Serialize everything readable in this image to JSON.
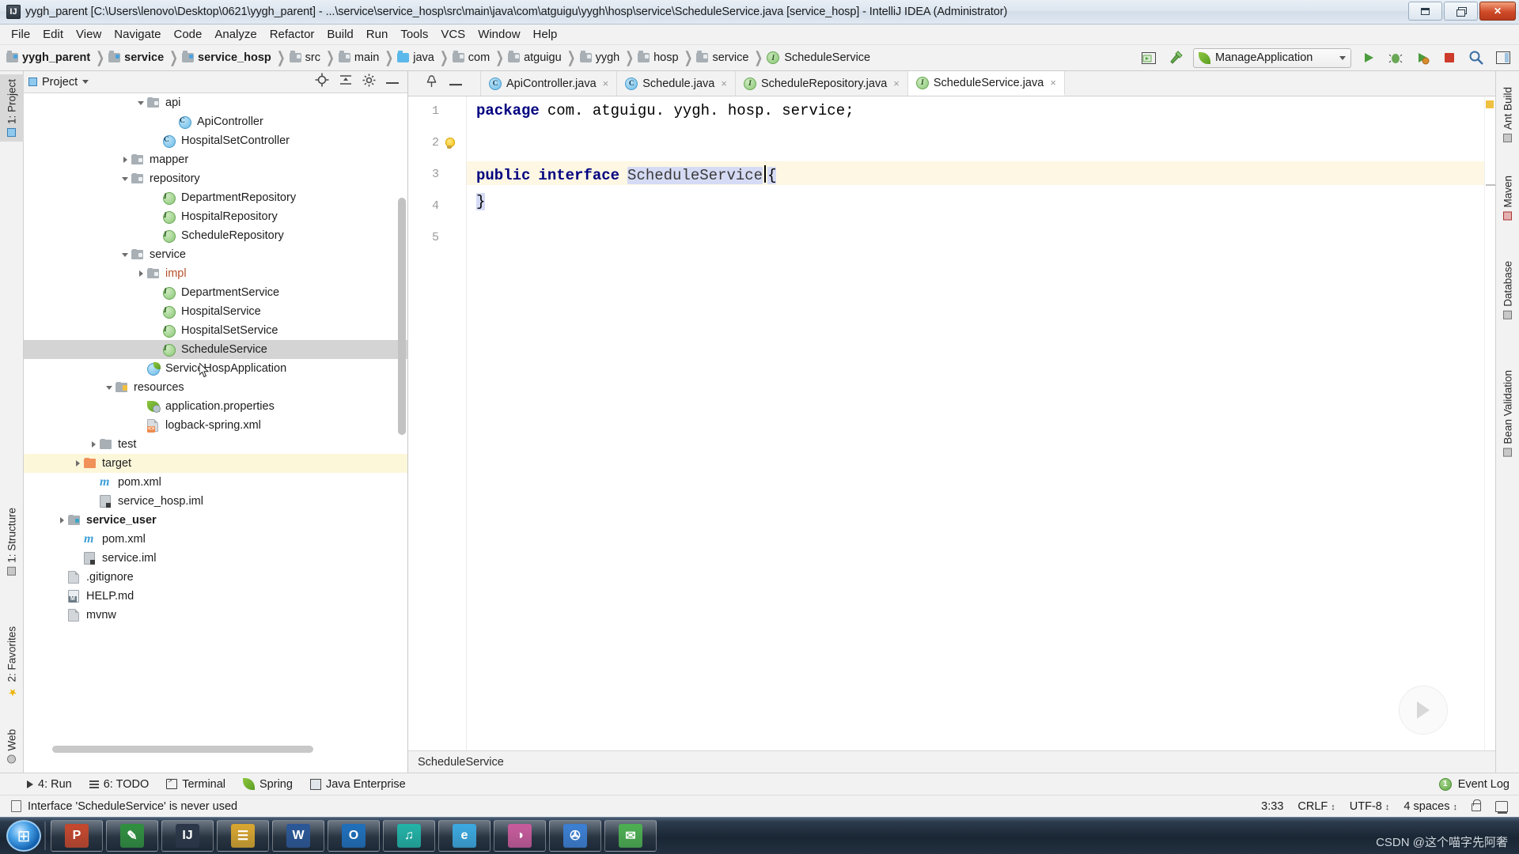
{
  "window": {
    "title": "yygh_parent [C:\\Users\\lenovo\\Desktop\\0621\\yygh_parent] - ...\\service\\service_hosp\\src\\main\\java\\com\\atguigu\\yygh\\hosp\\service\\ScheduleService.java [service_hosp] - IntelliJ IDEA (Administrator)",
    "app_badge": "IJ",
    "minimize_label": "Minimize",
    "restore_label": "Restore",
    "close_label": "✕"
  },
  "menubar": {
    "items": [
      "File",
      "Edit",
      "View",
      "Navigate",
      "Code",
      "Analyze",
      "Refactor",
      "Build",
      "Run",
      "Tools",
      "VCS",
      "Window",
      "Help"
    ]
  },
  "navbar": {
    "crumbs": [
      {
        "label": "yygh_parent",
        "icon": "folder-module-icon",
        "bold": true
      },
      {
        "label": "service",
        "icon": "folder-module-icon",
        "bold": true
      },
      {
        "label": "service_hosp",
        "icon": "folder-module-icon",
        "bold": true
      },
      {
        "label": "src",
        "icon": "folder-icon",
        "bold": false
      },
      {
        "label": "main",
        "icon": "folder-icon",
        "bold": false
      },
      {
        "label": "java",
        "icon": "folder-source-icon",
        "bold": false
      },
      {
        "label": "com",
        "icon": "folder-package-icon",
        "bold": false
      },
      {
        "label": "atguigu",
        "icon": "folder-package-icon",
        "bold": false
      },
      {
        "label": "yygh",
        "icon": "folder-package-icon",
        "bold": false
      },
      {
        "label": "hosp",
        "icon": "folder-package-icon",
        "bold": false
      },
      {
        "label": "service",
        "icon": "folder-package-icon",
        "bold": false
      },
      {
        "label": "ScheduleService",
        "icon": "interface-icon",
        "bold": false
      }
    ],
    "separator": "❯",
    "run_config": "ManageApplication",
    "buttons": {
      "run_dashboard": "Run Dashboard",
      "build": "Build Project",
      "run": "Run",
      "debug": "Debug",
      "coverage": "Run with Coverage",
      "stop": "Stop",
      "search": "Search Everywhere",
      "layout": "Layout"
    }
  },
  "left_strip": {
    "tabs": [
      {
        "label": "1: Project",
        "icon": "project-icon",
        "selected": true
      },
      {
        "label": "1: Structure",
        "icon": "structure-icon",
        "selected": false
      },
      {
        "label": "2: Favorites",
        "icon": "favorites-star-icon",
        "selected": false
      },
      {
        "label": "Web",
        "icon": "web-icon",
        "selected": false
      }
    ]
  },
  "right_strip": {
    "tabs": [
      "Ant Build",
      "Maven",
      "Database",
      "Bean Validation"
    ]
  },
  "project_panel": {
    "title": "Project",
    "dropdown_glyph": "▾",
    "buttons": {
      "locate": "Select Opened File",
      "collapse": "Collapse All",
      "settings": "Settings",
      "hide": "Hide"
    },
    "tree": [
      {
        "label": "api",
        "icon": "folder-package-icon",
        "indent": 7,
        "twist": "down",
        "state": "normal"
      },
      {
        "label": "ApiController",
        "icon": "class-icon",
        "indent": 9,
        "twist": "none",
        "state": "normal"
      },
      {
        "label": "HospitalSetController",
        "icon": "class-icon",
        "indent": 8,
        "twist": "none",
        "state": "normal"
      },
      {
        "label": "mapper",
        "icon": "folder-package-icon",
        "indent": 6,
        "twist": "right",
        "state": "normal"
      },
      {
        "label": "repository",
        "icon": "folder-package-icon",
        "indent": 6,
        "twist": "down",
        "state": "normal"
      },
      {
        "label": "DepartmentRepository",
        "icon": "interface-icon",
        "indent": 8,
        "twist": "none",
        "state": "normal"
      },
      {
        "label": "HospitalRepository",
        "icon": "interface-icon",
        "indent": 8,
        "twist": "none",
        "state": "normal"
      },
      {
        "label": "ScheduleRepository",
        "icon": "interface-icon",
        "indent": 8,
        "twist": "none",
        "state": "normal"
      },
      {
        "label": "service",
        "icon": "folder-package-icon",
        "indent": 6,
        "twist": "down",
        "state": "normal"
      },
      {
        "label": "impl",
        "icon": "folder-package-icon",
        "indent": 7,
        "twist": "right",
        "state": "red"
      },
      {
        "label": "DepartmentService",
        "icon": "interface-icon",
        "indent": 8,
        "twist": "none",
        "state": "normal"
      },
      {
        "label": "HospitalService",
        "icon": "interface-icon",
        "indent": 8,
        "twist": "none",
        "state": "normal"
      },
      {
        "label": "HospitalSetService",
        "icon": "interface-icon",
        "indent": 8,
        "twist": "none",
        "state": "normal"
      },
      {
        "label": "ScheduleService",
        "icon": "interface-icon",
        "indent": 8,
        "twist": "none",
        "state": "selected"
      },
      {
        "label": "ServiceHospApplication",
        "icon": "spring-class-icon",
        "indent": 7,
        "twist": "none",
        "state": "normal"
      },
      {
        "label": "resources",
        "icon": "folder-resources-icon",
        "indent": 5,
        "twist": "down",
        "state": "normal"
      },
      {
        "label": "application.properties",
        "icon": "properties-icon",
        "indent": 7,
        "twist": "none",
        "state": "normal"
      },
      {
        "label": "logback-spring.xml",
        "icon": "xml-icon",
        "indent": 7,
        "twist": "none",
        "state": "normal"
      },
      {
        "label": "test",
        "icon": "folder-icon",
        "indent": 4,
        "twist": "right",
        "state": "normal"
      },
      {
        "label": "target",
        "icon": "folder-excluded-icon",
        "indent": 3,
        "twist": "right",
        "state": "highlight"
      },
      {
        "label": "pom.xml",
        "icon": "maven-icon",
        "indent": 4,
        "twist": "none",
        "state": "normal"
      },
      {
        "label": "service_hosp.iml",
        "icon": "iml-icon",
        "indent": 4,
        "twist": "none",
        "state": "normal"
      },
      {
        "label": "service_user",
        "icon": "folder-module-icon",
        "indent": 2,
        "twist": "right",
        "state": "bold"
      },
      {
        "label": "pom.xml",
        "icon": "maven-icon",
        "indent": 3,
        "twist": "none",
        "state": "normal"
      },
      {
        "label": "service.iml",
        "icon": "iml-icon",
        "indent": 3,
        "twist": "none",
        "state": "normal"
      },
      {
        "label": ".gitignore",
        "icon": "file-icon",
        "indent": 2,
        "twist": "none",
        "state": "normal"
      },
      {
        "label": "HELP.md",
        "icon": "markdown-icon",
        "indent": 2,
        "twist": "none",
        "state": "normal"
      },
      {
        "label": "mvnw",
        "icon": "file-icon",
        "indent": 2,
        "twist": "none",
        "state": "normal"
      }
    ]
  },
  "editor": {
    "tabs": [
      {
        "label": "ApiController.java",
        "icon": "class-icon",
        "active": false,
        "close": "×"
      },
      {
        "label": "Schedule.java",
        "icon": "class-icon",
        "active": false,
        "close": "×"
      },
      {
        "label": "ScheduleRepository.java",
        "icon": "interface-icon",
        "active": false,
        "close": "×"
      },
      {
        "label": "ScheduleService.java",
        "icon": "interface-icon",
        "active": true,
        "close": "×"
      }
    ],
    "gutter_buttons": {
      "pin": "Pin Tab",
      "minimize": "Hide"
    },
    "line_numbers": [
      "1",
      "2",
      "3",
      "4",
      "5"
    ],
    "intention_bulb": "intention-bulb-icon",
    "code": {
      "line1_keyword": "package",
      "line1_rest": "com. atguigu. yygh. hosp. service;",
      "line3_kw1": "public",
      "line3_kw2": "interface",
      "line3_name": "ScheduleService",
      "line3_brace": "{",
      "line4": "}"
    },
    "breadcrumb": "ScheduleService"
  },
  "bottom_bar": {
    "items": [
      {
        "label": "4: Run",
        "mnemonic": "4",
        "icon": "run-icon"
      },
      {
        "label": "6: TODO",
        "mnemonic": "6",
        "icon": "todo-icon"
      },
      {
        "label": "Terminal",
        "mnemonic": "",
        "icon": "terminal-icon"
      },
      {
        "label": "Spring",
        "mnemonic": "",
        "icon": "spring-icon"
      },
      {
        "label": "Java Enterprise",
        "mnemonic": "",
        "icon": "java-enterprise-icon"
      }
    ],
    "event_log": {
      "label": "Event Log",
      "count": "1"
    }
  },
  "status_bar": {
    "message": "Interface 'ScheduleService' is never used",
    "position": "3:33",
    "line_separator": "CRLF",
    "encoding": "UTF-8",
    "indent": "4 spaces",
    "stepper_glyph": "↕",
    "lock": "read-only-lock-icon",
    "inspector": "inspector-icon"
  },
  "taskbar": {
    "start": "⊞",
    "apps": [
      {
        "name": "powerpoint-app",
        "letter": "P",
        "color": "#c5472c"
      },
      {
        "name": "editor-app",
        "letter": "✎",
        "color": "#2f8f3e"
      },
      {
        "name": "intellij-app",
        "letter": "IJ",
        "color": "#2b3648"
      },
      {
        "name": "explorer-app",
        "letter": "☰",
        "color": "#d9a62e"
      },
      {
        "name": "word-app",
        "letter": "W",
        "color": "#2b5797"
      },
      {
        "name": "outlook-app",
        "letter": "O",
        "color": "#1e6fbb"
      },
      {
        "name": "music-app",
        "letter": "♫",
        "color": "#21b3a6"
      },
      {
        "name": "browser-app",
        "letter": "e",
        "color": "#3ba9e0"
      },
      {
        "name": "paint-app",
        "letter": "◑",
        "color": "#c85a9b"
      },
      {
        "name": "tool-app",
        "letter": "✇",
        "color": "#3b7fd4"
      },
      {
        "name": "wechat-app",
        "letter": "✉",
        "color": "#4caf50"
      }
    ],
    "watermark": "CSDN @这个喵字先阿奢"
  }
}
